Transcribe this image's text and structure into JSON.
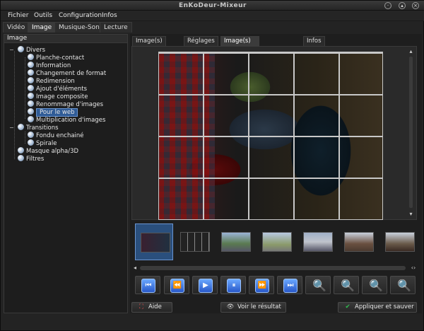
{
  "window": {
    "title": "EnKoDeur-Mixeur"
  },
  "menu": [
    "Fichier",
    "Outils",
    "Configuration",
    "Infos"
  ],
  "main_tabs": [
    "Vidéo",
    "Image",
    "Musique-Son",
    "Lecture"
  ],
  "left_panel": {
    "header": "Image",
    "tree": [
      {
        "label": "Divers",
        "level": 0,
        "expanded": true
      },
      {
        "label": "Planche-contact",
        "level": 1
      },
      {
        "label": "Information",
        "level": 1
      },
      {
        "label": "Changement de format",
        "level": 1
      },
      {
        "label": "Redimension",
        "level": 1
      },
      {
        "label": "Ajout d'éléments",
        "level": 1
      },
      {
        "label": "Image composite",
        "level": 1
      },
      {
        "label": "Renommage d'images",
        "level": 1
      },
      {
        "label": "Pour le web",
        "level": 1,
        "selected": true
      },
      {
        "label": "Multiplication d'images",
        "level": 1
      },
      {
        "label": "Transitions",
        "level": 0,
        "expanded": true
      },
      {
        "label": "Fondu enchainé",
        "level": 1
      },
      {
        "label": "Spirale",
        "level": 1
      },
      {
        "label": "Masque alpha/3D",
        "level": 0
      },
      {
        "label": "Filtres",
        "level": 0
      }
    ]
  },
  "sub_tabs": [
    "Image(s) source",
    "Réglages",
    "Image(s) après traitement",
    "Infos"
  ],
  "thumbnails": [
    "thumb-1",
    "thumb-2",
    "thumb-3",
    "thumb-4",
    "thumb-5",
    "thumb-6",
    "thumb-7"
  ],
  "bottom_buttons": {
    "help": "Aide",
    "view": "Voir le résultat",
    "apply": "Appliquer et sauver"
  },
  "colors": {
    "selection": "#2f5b96",
    "accent": "#3b8cff",
    "ok": "#2fbf4f"
  }
}
